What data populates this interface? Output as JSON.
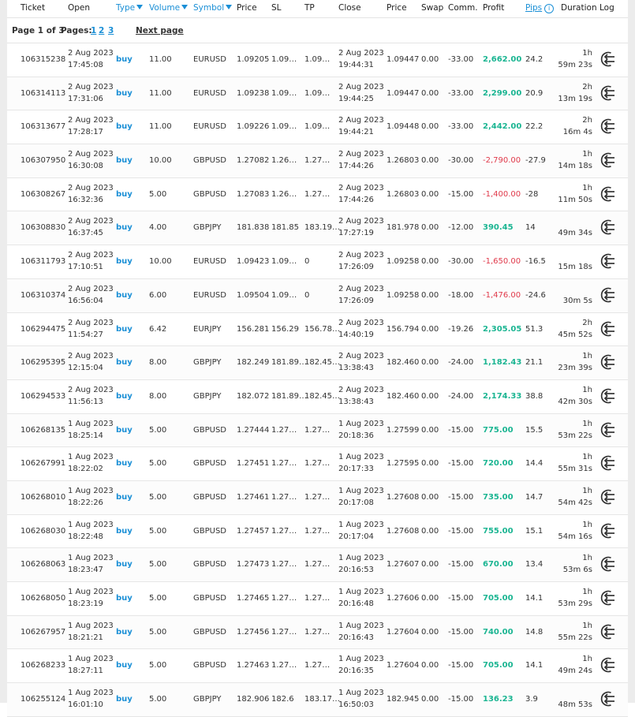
{
  "header": {
    "ticket": "Ticket",
    "open": "Open",
    "type": "Type",
    "volume": "Volume",
    "symbol": "Symbol",
    "price": "Price",
    "sl": "SL",
    "tp": "TP",
    "close": "Close",
    "close_price": "Price",
    "swap": "Swap",
    "comm": "Comm.",
    "profit": "Profit",
    "pips": "Pips",
    "duration": "Duration",
    "log": "Log"
  },
  "pagination": {
    "label": "Page 1 of 3",
    "pages_label": "Pages:",
    "pages": [
      "1",
      "2",
      "3"
    ],
    "next": "Next page"
  },
  "rows": [
    {
      "ticket": "106315238",
      "open_date": "2 Aug 2023",
      "open_time": "17:45:08",
      "type": "buy",
      "volume": "11.00",
      "symbol": "EURUSD",
      "price": "1.09205",
      "sl": "1.09…",
      "tp": "1.09…",
      "close_date": "2 Aug 2023",
      "close_time": "19:44:31",
      "close_price": "1.09447",
      "swap": "0.00",
      "comm": "-33.00",
      "profit": "2,662.00",
      "profit_sign": "pos",
      "pips": "24.2",
      "dur1": "1h",
      "dur2": "59m 23s"
    },
    {
      "ticket": "106314113",
      "open_date": "2 Aug 2023",
      "open_time": "17:31:06",
      "type": "buy",
      "volume": "11.00",
      "symbol": "EURUSD",
      "price": "1.09238",
      "sl": "1.09…",
      "tp": "1.09…",
      "close_date": "2 Aug 2023",
      "close_time": "19:44:25",
      "close_price": "1.09447",
      "swap": "0.00",
      "comm": "-33.00",
      "profit": "2,299.00",
      "profit_sign": "pos",
      "pips": "20.9",
      "dur1": "2h",
      "dur2": "13m 19s"
    },
    {
      "ticket": "106313677",
      "open_date": "2 Aug 2023",
      "open_time": "17:28:17",
      "type": "buy",
      "volume": "11.00",
      "symbol": "EURUSD",
      "price": "1.09226",
      "sl": "1.09…",
      "tp": "1.09…",
      "close_date": "2 Aug 2023",
      "close_time": "19:44:21",
      "close_price": "1.09448",
      "swap": "0.00",
      "comm": "-33.00",
      "profit": "2,442.00",
      "profit_sign": "pos",
      "pips": "22.2",
      "dur1": "2h",
      "dur2": "16m 4s"
    },
    {
      "ticket": "106307950",
      "open_date": "2 Aug 2023",
      "open_time": "16:30:08",
      "type": "buy",
      "volume": "10.00",
      "symbol": "GBPUSD",
      "price": "1.27082",
      "sl": "1.26…",
      "tp": "1.27…",
      "close_date": "2 Aug 2023",
      "close_time": "17:44:26",
      "close_price": "1.26803",
      "swap": "0.00",
      "comm": "-30.00",
      "profit": "-2,790.00",
      "profit_sign": "neg",
      "pips": "-27.9",
      "dur1": "1h",
      "dur2": "14m 18s"
    },
    {
      "ticket": "106308267",
      "open_date": "2 Aug 2023",
      "open_time": "16:32:36",
      "type": "buy",
      "volume": "5.00",
      "symbol": "GBPUSD",
      "price": "1.27083",
      "sl": "1.26…",
      "tp": "1.27…",
      "close_date": "2 Aug 2023",
      "close_time": "17:44:26",
      "close_price": "1.26803",
      "swap": "0.00",
      "comm": "-15.00",
      "profit": "-1,400.00",
      "profit_sign": "neg",
      "pips": "-28",
      "dur1": "1h",
      "dur2": "11m 50s"
    },
    {
      "ticket": "106308830",
      "open_date": "2 Aug 2023",
      "open_time": "16:37:45",
      "type": "buy",
      "volume": "4.00",
      "symbol": "GBPJPY",
      "price": "181.838",
      "sl": "181.85",
      "tp": "183.19…",
      "close_date": "2 Aug 2023",
      "close_time": "17:27:19",
      "close_price": "181.978",
      "swap": "0.00",
      "comm": "-12.00",
      "profit": "390.45",
      "profit_sign": "pos",
      "pips": "14",
      "dur1": "",
      "dur2": "49m 34s"
    },
    {
      "ticket": "106311793",
      "open_date": "2 Aug 2023",
      "open_time": "17:10:51",
      "type": "buy",
      "volume": "10.00",
      "symbol": "EURUSD",
      "price": "1.09423",
      "sl": "1.09…",
      "tp": "0",
      "close_date": "2 Aug 2023",
      "close_time": "17:26:09",
      "close_price": "1.09258",
      "swap": "0.00",
      "comm": "-30.00",
      "profit": "-1,650.00",
      "profit_sign": "neg",
      "pips": "-16.5",
      "dur1": "",
      "dur2": "15m 18s"
    },
    {
      "ticket": "106310374",
      "open_date": "2 Aug 2023",
      "open_time": "16:56:04",
      "type": "buy",
      "volume": "6.00",
      "symbol": "EURUSD",
      "price": "1.09504",
      "sl": "1.09…",
      "tp": "0",
      "close_date": "2 Aug 2023",
      "close_time": "17:26:09",
      "close_price": "1.09258",
      "swap": "0.00",
      "comm": "-18.00",
      "profit": "-1,476.00",
      "profit_sign": "neg",
      "pips": "-24.6",
      "dur1": "",
      "dur2": "30m 5s"
    },
    {
      "ticket": "106294475",
      "open_date": "2 Aug 2023",
      "open_time": "11:54:27",
      "type": "buy",
      "volume": "6.42",
      "symbol": "EURJPY",
      "price": "156.281",
      "sl": "156.29",
      "tp": "156.78…",
      "close_date": "2 Aug 2023",
      "close_time": "14:40:19",
      "close_price": "156.794",
      "swap": "0.00",
      "comm": "-19.26",
      "profit": "2,305.05",
      "profit_sign": "pos",
      "pips": "51.3",
      "dur1": "2h",
      "dur2": "45m 52s"
    },
    {
      "ticket": "106295395",
      "open_date": "2 Aug 2023",
      "open_time": "12:15:04",
      "type": "buy",
      "volume": "8.00",
      "symbol": "GBPJPY",
      "price": "182.249",
      "sl": "181.89…",
      "tp": "182.45…",
      "close_date": "2 Aug 2023",
      "close_time": "13:38:43",
      "close_price": "182.460",
      "swap": "0.00",
      "comm": "-24.00",
      "profit": "1,182.43",
      "profit_sign": "pos",
      "pips": "21.1",
      "dur1": "1h",
      "dur2": "23m 39s"
    },
    {
      "ticket": "106294533",
      "open_date": "2 Aug 2023",
      "open_time": "11:56:13",
      "type": "buy",
      "volume": "8.00",
      "symbol": "GBPJPY",
      "price": "182.072",
      "sl": "181.89…",
      "tp": "182.45…",
      "close_date": "2 Aug 2023",
      "close_time": "13:38:43",
      "close_price": "182.460",
      "swap": "0.00",
      "comm": "-24.00",
      "profit": "2,174.33",
      "profit_sign": "pos",
      "pips": "38.8",
      "dur1": "1h",
      "dur2": "42m 30s"
    },
    {
      "ticket": "106268135",
      "open_date": "1 Aug 2023",
      "open_time": "18:25:14",
      "type": "buy",
      "volume": "5.00",
      "symbol": "GBPUSD",
      "price": "1.27444",
      "sl": "1.27…",
      "tp": "1.27…",
      "close_date": "1 Aug 2023",
      "close_time": "20:18:36",
      "close_price": "1.27599",
      "swap": "0.00",
      "comm": "-15.00",
      "profit": "775.00",
      "profit_sign": "pos",
      "pips": "15.5",
      "dur1": "1h",
      "dur2": "53m 22s"
    },
    {
      "ticket": "106267991",
      "open_date": "1 Aug 2023",
      "open_time": "18:22:02",
      "type": "buy",
      "volume": "5.00",
      "symbol": "GBPUSD",
      "price": "1.27451",
      "sl": "1.27…",
      "tp": "1.27…",
      "close_date": "1 Aug 2023",
      "close_time": "20:17:33",
      "close_price": "1.27595",
      "swap": "0.00",
      "comm": "-15.00",
      "profit": "720.00",
      "profit_sign": "pos",
      "pips": "14.4",
      "dur1": "1h",
      "dur2": "55m 31s"
    },
    {
      "ticket": "106268010",
      "open_date": "1 Aug 2023",
      "open_time": "18:22:26",
      "type": "buy",
      "volume": "5.00",
      "symbol": "GBPUSD",
      "price": "1.27461",
      "sl": "1.27…",
      "tp": "1.27…",
      "close_date": "1 Aug 2023",
      "close_time": "20:17:08",
      "close_price": "1.27608",
      "swap": "0.00",
      "comm": "-15.00",
      "profit": "735.00",
      "profit_sign": "pos",
      "pips": "14.7",
      "dur1": "1h",
      "dur2": "54m 42s"
    },
    {
      "ticket": "106268030",
      "open_date": "1 Aug 2023",
      "open_time": "18:22:48",
      "type": "buy",
      "volume": "5.00",
      "symbol": "GBPUSD",
      "price": "1.27457",
      "sl": "1.27…",
      "tp": "1.27…",
      "close_date": "1 Aug 2023",
      "close_time": "20:17:04",
      "close_price": "1.27608",
      "swap": "0.00",
      "comm": "-15.00",
      "profit": "755.00",
      "profit_sign": "pos",
      "pips": "15.1",
      "dur1": "1h",
      "dur2": "54m 16s"
    },
    {
      "ticket": "106268063",
      "open_date": "1 Aug 2023",
      "open_time": "18:23:47",
      "type": "buy",
      "volume": "5.00",
      "symbol": "GBPUSD",
      "price": "1.27473",
      "sl": "1.27…",
      "tp": "1.27…",
      "close_date": "1 Aug 2023",
      "close_time": "20:16:53",
      "close_price": "1.27607",
      "swap": "0.00",
      "comm": "-15.00",
      "profit": "670.00",
      "profit_sign": "pos",
      "pips": "13.4",
      "dur1": "1h",
      "dur2": "53m 6s"
    },
    {
      "ticket": "106268050",
      "open_date": "1 Aug 2023",
      "open_time": "18:23:19",
      "type": "buy",
      "volume": "5.00",
      "symbol": "GBPUSD",
      "price": "1.27465",
      "sl": "1.27…",
      "tp": "1.27…",
      "close_date": "1 Aug 2023",
      "close_time": "20:16:48",
      "close_price": "1.27606",
      "swap": "0.00",
      "comm": "-15.00",
      "profit": "705.00",
      "profit_sign": "pos",
      "pips": "14.1",
      "dur1": "1h",
      "dur2": "53m 29s"
    },
    {
      "ticket": "106267957",
      "open_date": "1 Aug 2023",
      "open_time": "18:21:21",
      "type": "buy",
      "volume": "5.00",
      "symbol": "GBPUSD",
      "price": "1.27456",
      "sl": "1.27…",
      "tp": "1.27…",
      "close_date": "1 Aug 2023",
      "close_time": "20:16:43",
      "close_price": "1.27604",
      "swap": "0.00",
      "comm": "-15.00",
      "profit": "740.00",
      "profit_sign": "pos",
      "pips": "14.8",
      "dur1": "1h",
      "dur2": "55m 22s"
    },
    {
      "ticket": "106268233",
      "open_date": "1 Aug 2023",
      "open_time": "18:27:11",
      "type": "buy",
      "volume": "5.00",
      "symbol": "GBPUSD",
      "price": "1.27463",
      "sl": "1.27…",
      "tp": "1.27…",
      "close_date": "1 Aug 2023",
      "close_time": "20:16:35",
      "close_price": "1.27604",
      "swap": "0.00",
      "comm": "-15.00",
      "profit": "705.00",
      "profit_sign": "pos",
      "pips": "14.1",
      "dur1": "1h",
      "dur2": "49m 24s"
    },
    {
      "ticket": "106255124",
      "open_date": "1 Aug 2023",
      "open_time": "16:01:10",
      "type": "buy",
      "volume": "5.00",
      "symbol": "GBPJPY",
      "price": "182.906",
      "sl": "182.6",
      "tp": "183.17…",
      "close_date": "1 Aug 2023",
      "close_time": "16:50:03",
      "close_price": "182.945",
      "swap": "0.00",
      "comm": "-15.00",
      "profit": "136.23",
      "profit_sign": "pos",
      "pips": "3.9",
      "dur1": "",
      "dur2": "48m 53s"
    }
  ],
  "icons": {
    "log": "exit-log-icon",
    "info": "info-icon",
    "sort": "sort-triangle-icon"
  },
  "colors": {
    "link": "#1a8fd6",
    "positive": "#1bb592",
    "negative": "#e0394a"
  }
}
